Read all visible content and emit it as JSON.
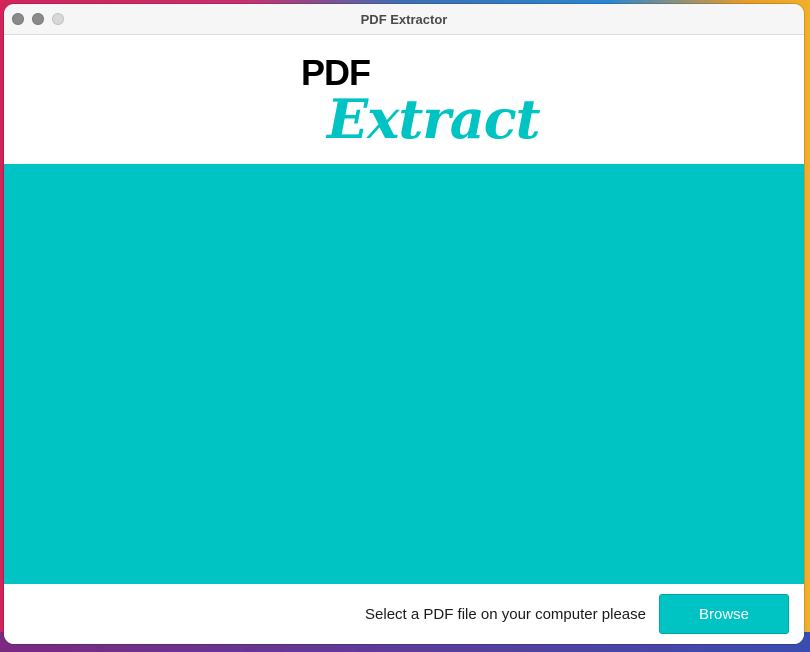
{
  "window": {
    "title": "PDF Extractor"
  },
  "logo": {
    "line1": "PDF",
    "line2": "Extract"
  },
  "footer": {
    "prompt": "Select a PDF file on your computer please",
    "browse_label": "Browse"
  },
  "colors": {
    "accent": "#00c4c4",
    "text": "#1a1a1a",
    "window_bg": "#ffffff"
  },
  "icons": {
    "close": "close-dot-icon",
    "minimize": "minimize-dot-icon",
    "zoom": "zoom-dot-icon"
  }
}
